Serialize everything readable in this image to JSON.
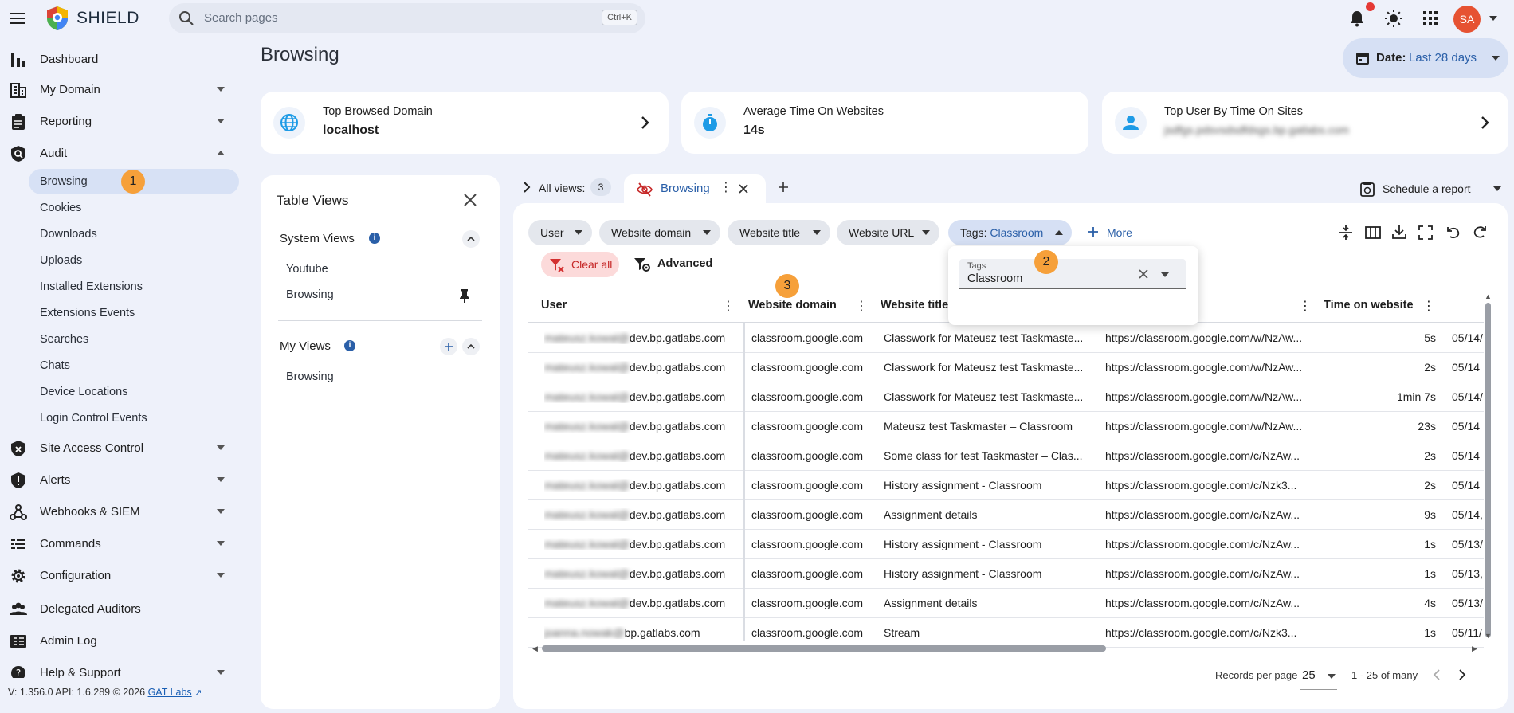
{
  "app": {
    "brand": "SHIELD"
  },
  "search": {
    "placeholder": "Search pages",
    "shortcut": "Ctrl+K"
  },
  "user": {
    "initials": "SA"
  },
  "sidebar": {
    "items": [
      {
        "label": "Dashboard",
        "icon": "bar-chart-icon"
      },
      {
        "label": "My Domain",
        "icon": "domain-icon"
      },
      {
        "label": "Reporting",
        "icon": "clipboard-icon"
      },
      {
        "label": "Audit",
        "icon": "audit-shield-icon"
      },
      {
        "label": "Site Access Control",
        "icon": "shield-lock-icon"
      },
      {
        "label": "Alerts",
        "icon": "alert-shield-icon"
      },
      {
        "label": "Webhooks & SIEM",
        "icon": "webhook-icon"
      },
      {
        "label": "Commands",
        "icon": "commands-icon"
      },
      {
        "label": "Configuration",
        "icon": "gear-icon"
      },
      {
        "label": "Delegated Auditors",
        "icon": "people-icon"
      },
      {
        "label": "Admin Log",
        "icon": "log-icon"
      },
      {
        "label": "Help & Support",
        "icon": "help-icon"
      }
    ],
    "audit_sub": [
      "Browsing",
      "Cookies",
      "Downloads",
      "Uploads",
      "Installed Extensions",
      "Extensions Events",
      "Searches",
      "Chats",
      "Device Locations",
      "Login Control Events"
    ]
  },
  "badges": {
    "one": "1",
    "two": "2",
    "three": "3"
  },
  "footer": {
    "version": "V: 1.356.0   API: 1.6.289   © 2026",
    "link": "GAT Labs"
  },
  "page": {
    "title": "Browsing"
  },
  "date": {
    "label": "Date:",
    "value": "Last 28 days"
  },
  "cards": [
    {
      "title": "Top Browsed Domain",
      "value": "localhost",
      "icon": "globe-icon"
    },
    {
      "title": "Average Time On Websites",
      "value": "14s",
      "icon": "timer-icon"
    },
    {
      "title": "Top User By Time On Sites",
      "value": "jsdfgs.pdsvsdsdfdsgs.bp.gatlabs.com",
      "icon": "person-icon"
    }
  ],
  "table_views": {
    "title": "Table Views",
    "system_title": "System Views",
    "system_items": [
      "Youtube",
      "Browsing"
    ],
    "my_title": "My Views",
    "my_items": [
      "Browsing"
    ]
  },
  "tabs": {
    "all_views_label": "All views:",
    "all_views_count": "3",
    "active_tab": "Browsing",
    "schedule": "Schedule a report"
  },
  "filters": {
    "chips": [
      "User",
      "Website domain",
      "Website title",
      "Website URL"
    ],
    "tags_label": "Tags:",
    "tags_value": "Classroom",
    "more": "More",
    "clear_all": "Clear all",
    "advanced": "Advanced"
  },
  "tags_popup": {
    "label": "Tags",
    "value": "Classroom"
  },
  "table": {
    "columns": [
      "User",
      "Website domain",
      "Website title",
      "Time on website"
    ],
    "rows": [
      {
        "user": "mateusz.kowal@dev.bp.gatlabs.com",
        "domain": "classroom.google.com",
        "title": "Classwork for Mateusz test Taskmaste...",
        "url": "https://classroom.google.com/w/NzAw...",
        "time": "5s",
        "date": "05/14/"
      },
      {
        "user": "mateusz.kowal@dev.bp.gatlabs.com",
        "domain": "classroom.google.com",
        "title": "Classwork for Mateusz test Taskmaste...",
        "url": "https://classroom.google.com/w/NzAw...",
        "time": "2s",
        "date": "05/14"
      },
      {
        "user": "mateusz.kowal@dev.bp.gatlabs.com",
        "domain": "classroom.google.com",
        "title": "Classwork for Mateusz test Taskmaste...",
        "url": "https://classroom.google.com/w/NzAw...",
        "time": "1min 7s",
        "date": "05/14/"
      },
      {
        "user": "mateusz.kowal@dev.bp.gatlabs.com",
        "domain": "classroom.google.com",
        "title": "Mateusz test Taskmaster – Classroom",
        "url": "https://classroom.google.com/w/NzAw...",
        "time": "23s",
        "date": "05/14"
      },
      {
        "user": "mateusz.kowal@dev.bp.gatlabs.com",
        "domain": "classroom.google.com",
        "title": "Some class for test Taskmaster – Clas...",
        "url": "https://classroom.google.com/c/NzAw...",
        "time": "2s",
        "date": "05/14"
      },
      {
        "user": "mateusz.kowal@dev.bp.gatlabs.com",
        "domain": "classroom.google.com",
        "title": "History assignment - Classroom",
        "url": "https://classroom.google.com/c/Nzk3...",
        "time": "2s",
        "date": "05/14"
      },
      {
        "user": "mateusz.kowal@dev.bp.gatlabs.com",
        "domain": "classroom.google.com",
        "title": "Assignment details",
        "url": "https://classroom.google.com/c/NzAw...",
        "time": "9s",
        "date": "05/14,"
      },
      {
        "user": "mateusz.kowal@dev.bp.gatlabs.com",
        "domain": "classroom.google.com",
        "title": "History assignment - Classroom",
        "url": "https://classroom.google.com/c/NzAw...",
        "time": "1s",
        "date": "05/13/"
      },
      {
        "user": "mateusz.kowal@dev.bp.gatlabs.com",
        "domain": "classroom.google.com",
        "title": "History assignment - Classroom",
        "url": "https://classroom.google.com/c/NzAw...",
        "time": "1s",
        "date": "05/13,"
      },
      {
        "user": "mateusz.kowal@dev.bp.gatlabs.com",
        "domain": "classroom.google.com",
        "title": "Assignment details",
        "url": "https://classroom.google.com/c/NzAw...",
        "time": "4s",
        "date": "05/13/"
      },
      {
        "user": "joanna.nowak@bp.gatlabs.com",
        "domain": "classroom.google.com",
        "title": "Stream",
        "url": "https://classroom.google.com/c/Nzk3...",
        "time": "1s",
        "date": "05/11/"
      }
    ]
  },
  "pagination": {
    "label": "Records per page",
    "size": "25",
    "range": "1 - 25 of many"
  }
}
